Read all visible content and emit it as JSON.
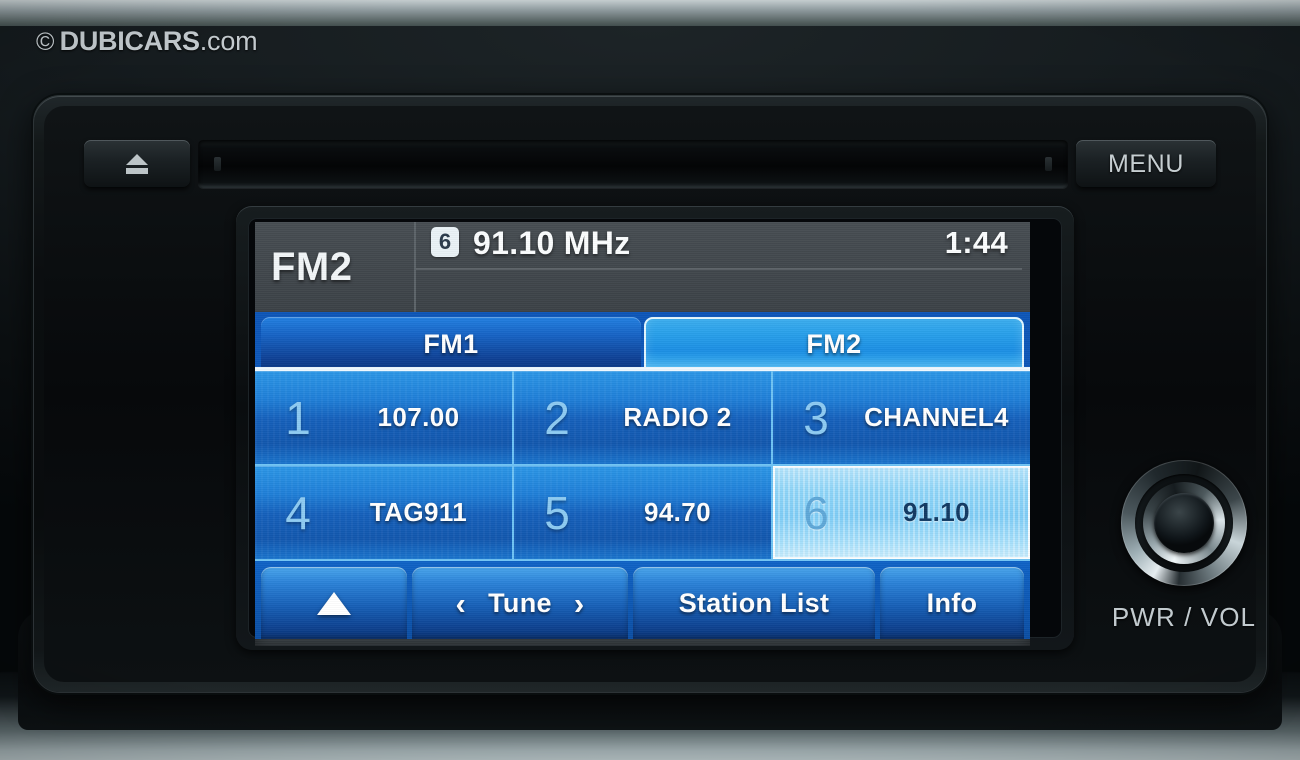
{
  "watermark": {
    "copyright": "©",
    "brand": "DUBICARS",
    "tld": ".com"
  },
  "faceplate": {
    "eject_icon": "eject-icon",
    "eject_label": "",
    "cd_slot_label": "",
    "menu_label": "MENU",
    "knob_label": "PWR / VOL",
    "knob_icon": "rotary-knob-icon"
  },
  "screen": {
    "header": {
      "band_label": "FM2",
      "preset_badge": "6",
      "frequency": "91.10 MHz",
      "clock": "1:44"
    },
    "tabs": [
      {
        "label": "FM1",
        "active": false
      },
      {
        "label": "FM2",
        "active": true
      }
    ],
    "presets": [
      {
        "number": "1",
        "name": "107.00",
        "selected": false
      },
      {
        "number": "2",
        "name": "RADIO 2",
        "selected": false
      },
      {
        "number": "3",
        "name": "CHANNEL4",
        "selected": false
      },
      {
        "number": "4",
        "name": "TAG911",
        "selected": false
      },
      {
        "number": "5",
        "name": "94.70",
        "selected": false
      },
      {
        "number": "6",
        "name": "91.10",
        "selected": true
      }
    ],
    "functions": {
      "up_icon": "triangle-up-icon",
      "up_label": "",
      "tune_prev_icon": "‹",
      "tune_label": "Tune",
      "tune_next_icon": "›",
      "station_list_label": "Station List",
      "info_label": "Info"
    },
    "ghost_reflection": {
      "left": "6 91.10 MHz",
      "right": "1:44"
    }
  },
  "colors": {
    "lcd_header_bg": "#41474c",
    "tab_active": "#29a0ea",
    "tab_inactive": "#1763c4",
    "preset_bg": "#1f7fd8",
    "preset_selected_bg": "#8ed5f8",
    "preset_selected_text": "#123a63",
    "accent_blue": "#0d56b8",
    "text_white": "#ffffff",
    "bezel_black": "#0b0e10",
    "chrome": "#c9d5d9"
  }
}
